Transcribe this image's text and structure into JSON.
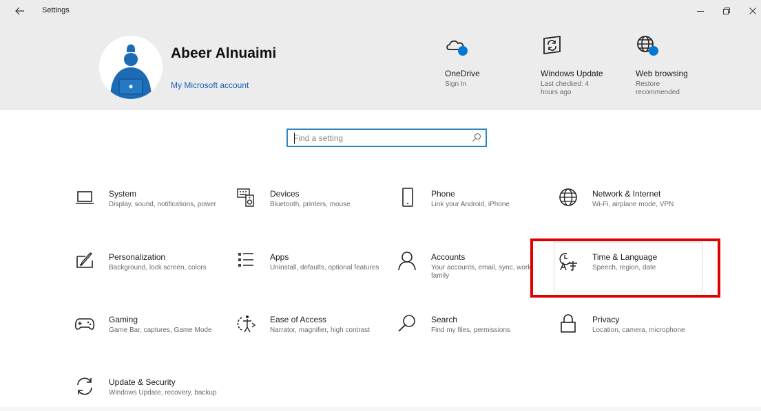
{
  "window": {
    "title": "Settings"
  },
  "account": {
    "name": "Abeer Alnuaimi",
    "link": "My Microsoft account"
  },
  "quick_links": [
    {
      "title": "OneDrive",
      "subtitle": "Sign In",
      "icon": "onedrive-cloud-icon"
    },
    {
      "title": "Windows Update",
      "subtitle": "Last checked: 4 hours ago",
      "icon": "windows-update-icon"
    },
    {
      "title": "Web browsing",
      "subtitle": "Restore recommended",
      "icon": "web-browsing-globe-icon"
    }
  ],
  "search": {
    "placeholder": "Find a setting"
  },
  "categories": [
    {
      "title": "System",
      "subtitle": "Display, sound, notifications, power",
      "icon": "laptop-icon"
    },
    {
      "title": "Devices",
      "subtitle": "Bluetooth, printers, mouse",
      "icon": "keyboard-speaker-icon"
    },
    {
      "title": "Phone",
      "subtitle": "Link your Android, iPhone",
      "icon": "phone-icon"
    },
    {
      "title": "Network & Internet",
      "subtitle": "Wi-Fi, airplane mode, VPN",
      "icon": "globe-icon"
    },
    {
      "title": "Personalization",
      "subtitle": "Background, lock screen, colors",
      "icon": "paint-brush-icon"
    },
    {
      "title": "Apps",
      "subtitle": "Uninstall, defaults, optional features",
      "icon": "apps-list-icon"
    },
    {
      "title": "Accounts",
      "subtitle": "Your accounts, email, sync, work, family",
      "icon": "person-icon"
    },
    {
      "title": "Time & Language",
      "subtitle": "Speech, region, date",
      "icon": "time-language-icon"
    },
    {
      "title": "Gaming",
      "subtitle": "Game Bar, captures, Game Mode",
      "icon": "gamepad-icon"
    },
    {
      "title": "Ease of Access",
      "subtitle": "Narrator, magnifier, high contrast",
      "icon": "ease-of-access-icon"
    },
    {
      "title": "Search",
      "subtitle": "Find my files, permissions",
      "icon": "search-icon"
    },
    {
      "title": "Privacy",
      "subtitle": "Location, camera, microphone",
      "icon": "lock-icon"
    },
    {
      "title": "Update & Security",
      "subtitle": "Windows Update, recovery, backup",
      "icon": "sync-arrows-icon"
    }
  ],
  "colors": {
    "accent": "#0078d4",
    "highlight": "#e00000",
    "header_bg": "#ececec"
  }
}
